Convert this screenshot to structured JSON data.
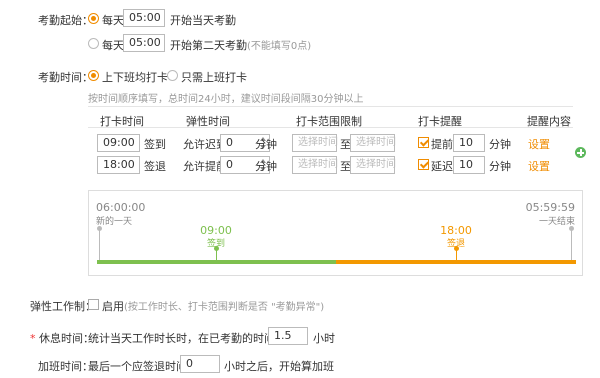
{
  "start": {
    "label": "考勤起始：",
    "opt1": {
      "radio": "每天",
      "time": "05:00",
      "desc": "开始当天考勤"
    },
    "opt2": {
      "radio": "每天",
      "time": "05:00",
      "desc": "开始第二天考勤",
      "note": "(不能填写0点)"
    }
  },
  "attend": {
    "label": "考勤时间：",
    "mode1": "上下班均打卡",
    "mode2": "只需上班打卡",
    "hint": "按时间顺序填写，总时间24小时，建议时间段间隔30分钟以上"
  },
  "table": {
    "headers": [
      "打卡时间",
      "弹性时间",
      "打卡范围限制",
      "打卡提醒",
      "提醒内容"
    ],
    "rows": [
      {
        "time": "09:00",
        "type": "签到",
        "flex_label": "允许迟到",
        "flex_value": "0",
        "flex_unit": "分钟",
        "range_from": "选择时间",
        "range_sep": "至",
        "range_to": "选择时间",
        "remind_label": "提前",
        "remind_value": "10",
        "remind_unit": "分钟",
        "content": "设置"
      },
      {
        "time": "18:00",
        "type": "签退",
        "flex_label": "允许提前",
        "flex_value": "0",
        "flex_unit": "分钟",
        "range_from": "选择时间",
        "range_sep": "至",
        "range_to": "选择时间",
        "remind_label": "延迟",
        "remind_value": "10",
        "remind_unit": "分钟",
        "content": "设置"
      }
    ],
    "add_icon": "plus-circle-icon"
  },
  "timeline": {
    "start_time": "06:00:00",
    "start_sub": "新的一天",
    "end_time": "05:59:59",
    "end_sub": "一天结束",
    "checkin_time": "09:00",
    "checkin_label": "签到",
    "checkout_time": "18:00",
    "checkout_label": "签退",
    "colors": {
      "green": "#7ec04f",
      "orange": "#f39800"
    }
  },
  "elastic": {
    "label": "弹性工作制：",
    "checkbox": "启用",
    "desc": "(按工作时长、打卡范围判断是否 \"考勤异常\")"
  },
  "rest": {
    "required": "*",
    "label": "休息时间：",
    "desc": "统计当天工作时长时，在已考勤的时间里减去",
    "value": "1.5",
    "unit": "小时"
  },
  "overtime": {
    "label": "加班时间：",
    "desc": "最后一个应签退时间的",
    "value": "0",
    "desc2": "小时之后，开始算加班"
  }
}
